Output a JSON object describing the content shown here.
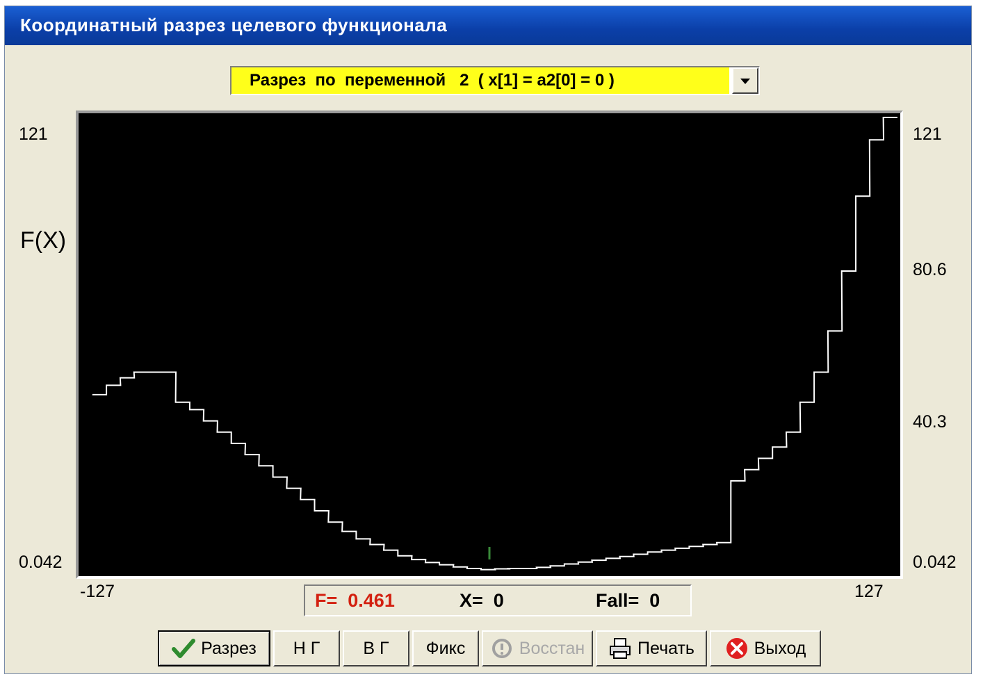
{
  "window": {
    "title": "Координатный разрез целевого функционала"
  },
  "combo": {
    "selected": "Разрез  по  переменной   2  ( x[1] = a2[0] = 0 )"
  },
  "axis": {
    "y_label": "F(X)",
    "left_ticks": [
      "121",
      "0.042"
    ],
    "right_ticks": [
      "121",
      "80.6",
      "40.3",
      "0.042"
    ],
    "x_min": "-127",
    "x_max": "127"
  },
  "status": {
    "f": "F=  0.461",
    "x": "X=  0",
    "fall": "Fall=  0"
  },
  "buttons": [
    {
      "label": "Разрез",
      "icon": "checkmark-icon"
    },
    {
      "label": "Н Г",
      "icon": ""
    },
    {
      "label": "В Г",
      "icon": ""
    },
    {
      "label": "Фикс",
      "icon": ""
    },
    {
      "label": "Восстан",
      "icon": "restore-icon",
      "disabled": true
    },
    {
      "label": "Печать",
      "icon": "printer-icon"
    },
    {
      "label": "Выход",
      "icon": "close-icon"
    }
  ],
  "colors": {
    "curve": "#ffffff",
    "marker": "#3a8a3a",
    "plot_bg": "#000000",
    "combo_bg": "#ffff1a",
    "f_value": "#d32010"
  },
  "chart_data": {
    "type": "line",
    "xlim": [
      -127,
      127
    ],
    "ylim": [
      0.042,
      121
    ],
    "marker_x": 0,
    "x": [
      -124,
      -119.6,
      -115.3,
      -111,
      -106.6,
      -102.3,
      -98,
      -93.6,
      -89.3,
      -85,
      -80.6,
      -76.3,
      -72,
      -67.6,
      -63.3,
      -59,
      -54.6,
      -50.3,
      -46,
      -41.6,
      -37.3,
      -33,
      -28.6,
      -24.3,
      -20,
      -15.6,
      -11.3,
      -7,
      -2.6,
      1.7,
      6,
      10.4,
      14.7,
      19,
      23.4,
      27.7,
      32,
      36.4,
      40.7,
      45,
      49.4,
      53.7,
      58,
      62.4,
      66.7,
      71,
      75.4,
      79.7,
      84,
      88.4,
      92.7,
      97,
      101.4,
      105.7,
      110,
      114.4,
      118.7,
      123
    ],
    "values": [
      47,
      49.5,
      51.5,
      53,
      53,
      53,
      45,
      43,
      40,
      37,
      34,
      31,
      28,
      25,
      22,
      19,
      16,
      13,
      10.5,
      8.5,
      7,
      5.5,
      4,
      3,
      2.2,
      1.6,
      1,
      0.6,
      0.3,
      0.5,
      0.6,
      0.6,
      0.9,
      1.3,
      1.8,
      2.3,
      2.8,
      3.3,
      3.8,
      4.4,
      5,
      5.5,
      6,
      6.5,
      7,
      7.5,
      24,
      27,
      30,
      33,
      37,
      45,
      53,
      64,
      80,
      100,
      115,
      121
    ]
  }
}
